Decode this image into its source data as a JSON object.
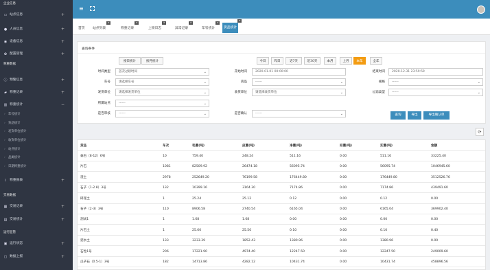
{
  "sidebar": {
    "sections": [
      {
        "title": "企业信息",
        "items": [
          {
            "label": "站点信息",
            "icon": "monitor-icon",
            "plus": "+"
          },
          {
            "label": "人员信息",
            "icon": "person-icon",
            "plus": "+"
          },
          {
            "label": "设备信息",
            "icon": "camera-icon",
            "plus": "+"
          },
          {
            "label": "配置管理",
            "icon": "gear-icon",
            "plus": "+"
          }
        ]
      },
      {
        "title": "称重数据",
        "items": [
          {
            "label": "预警信息",
            "icon": "info-icon",
            "plus": "+"
          },
          {
            "label": "称重记录",
            "icon": "truck-icon",
            "plus": "+"
          },
          {
            "label": "称重统计",
            "icon": "chart-icon",
            "plus": "−"
          }
        ],
        "subitems": [
          "车号统计",
          "货品统计",
          "发货单位统计",
          "收货单位统计",
          "站点统计",
          "品类统计",
          "日期称重统计"
        ],
        "after": [
          {
            "label": "称重报表",
            "icon": "line-chart-icon",
            "plus": "+"
          }
        ]
      },
      {
        "title": "交易数据",
        "items": [
          {
            "label": "交易记录",
            "icon": "table-icon",
            "plus": "+"
          },
          {
            "label": "交易统计",
            "icon": "stats-icon",
            "plus": "+"
          }
        ]
      },
      {
        "title": "运行监管",
        "items": [
          {
            "label": "运行状态",
            "icon": "status-icon",
            "plus": "+"
          },
          {
            "label": "数据上报",
            "icon": "upload-icon",
            "plus": "+"
          }
        ]
      }
    ]
  },
  "tabs": [
    "首页",
    "站点列表",
    "称重记录",
    "上磅日志",
    "异常记录",
    "车号统计",
    "货品统计"
  ],
  "tab_close": "×",
  "panel": {
    "title": "查询条件",
    "toggle": [
      "按日统计",
      "按月统计"
    ],
    "quick": [
      "今日",
      "昨日",
      "近7天",
      "近30天",
      "本月",
      "上月",
      "本年",
      "全年"
    ],
    "labels": {
      "time_type": "时间类型",
      "car": "车号",
      "sender": "发货单位",
      "station": "所属站点",
      "fixed": "是否审核",
      "start": "开始时间",
      "goods": "货品",
      "receiver": "收货单位",
      "end": "结束时间",
      "spec": "规格",
      "filter": "过滤类型",
      "confirm": "是否确认"
    },
    "values": {
      "time_type": "首次过磅时间",
      "car": "请选择车号",
      "sender": "请选择发货单位",
      "station": "------",
      "fixed": "------",
      "start": "2020-01-01 00:00:00",
      "goods": "------",
      "receiver": "请选择收货单位",
      "end": "2020-12-31 23:59:59",
      "spec": "------",
      "filter": "------",
      "confirm": "------"
    },
    "buttons": [
      "查询",
      "导出",
      "导出确认单"
    ]
  },
  "table": {
    "headers": [
      "货品",
      "车次",
      "毛重(吨)",
      "皮重(吨)",
      "净重(吨)",
      "扣重(吨)",
      "实重(吨)",
      "金额"
    ],
    "rows": [
      [
        "泰石（8-12）6号",
        "10",
        "759.40",
        "248.24",
        "511.16",
        "0.00",
        "511.16",
        "33225.40"
      ],
      [
        "片石",
        "1081",
        "82509.92",
        "26474.18",
        "56095.74",
        "0.00",
        "56095.74",
        "1046945.60"
      ],
      [
        "渣土",
        "2978",
        "252649.20",
        "76199.58",
        "176449.80",
        "0.00",
        "176449.80",
        "3512526.76"
      ],
      [
        "石子（1-2.8）3号",
        "132",
        "10399.16",
        "3164.30",
        "7174.86",
        "0.00",
        "7174.86",
        "439491.60"
      ],
      [
        "碎泥土",
        "1",
        "25.24",
        "25.12",
        "0.12",
        "0.00",
        "0.12",
        "0.00"
      ],
      [
        "石子（2-3）3号",
        "110",
        "8906.58",
        "2740.54",
        "6165.04",
        "0.00",
        "6165.04",
        "369902.40"
      ],
      [
        "测试1",
        "1",
        "1.68",
        "1.68",
        "0.00",
        "0.00",
        "0.00",
        "0.00"
      ],
      [
        "片石土",
        "1",
        "25.60",
        "25.50",
        "0.10",
        "0.00",
        "0.10",
        "0.40"
      ],
      [
        "泥水土",
        "133",
        "3233.39",
        "1852.43",
        "1380.96",
        "0.00",
        "1380.96",
        "0.00"
      ],
      [
        "石粒1号",
        "206",
        "17221.90",
        "4974.40",
        "12247.50",
        "0.00",
        "12247.50",
        "249009.60"
      ],
      [
        "瓜子石（0.5-1）3号",
        "182",
        "14713.86",
        "4282.12",
        "10431.74",
        "0.00",
        "10431.74",
        "458896.56"
      ]
    ]
  },
  "colors": {
    "accent": "#3c8dbc",
    "active_quick": "#f39c12",
    "sidebar": "#2f3542"
  }
}
